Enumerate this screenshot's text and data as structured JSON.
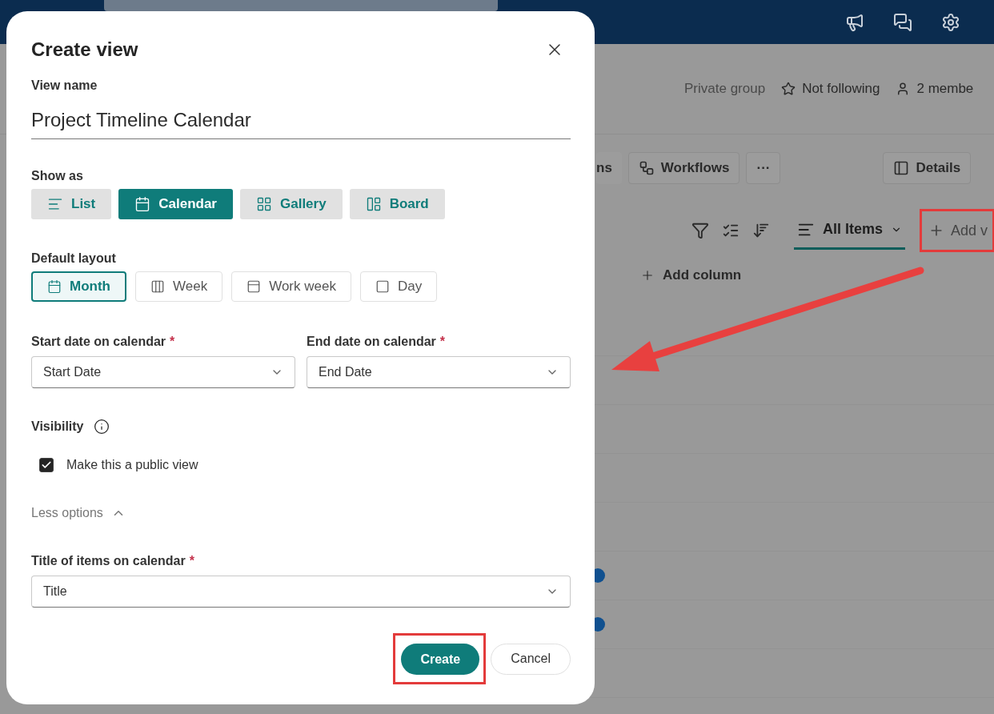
{
  "page": {
    "header": {
      "privacy": "Private group",
      "follow": "Not following",
      "members": "2 membe"
    },
    "toolbar": {
      "cut_label": "ns",
      "workflows": "Workflows",
      "more": "···",
      "details": "Details"
    },
    "views": {
      "current": {
        "label": "All Items",
        "selected": true
      },
      "add": "Add v"
    },
    "add_column": "Add column",
    "rows": [
      {
        "indicator": false
      },
      {
        "indicator": false
      },
      {
        "indicator": false
      },
      {
        "indicator": false
      },
      {
        "indicator": false
      },
      {
        "indicator": true
      },
      {
        "indicator": true
      },
      {
        "indicator": false
      }
    ]
  },
  "dialog": {
    "title": "Create view",
    "view_name": {
      "label": "View name",
      "value": "Project Timeline Calendar"
    },
    "show_as": {
      "label": "Show as",
      "options": [
        {
          "label": "List",
          "selected": false
        },
        {
          "label": "Calendar",
          "selected": true
        },
        {
          "label": "Gallery",
          "selected": false
        },
        {
          "label": "Board",
          "selected": false
        }
      ]
    },
    "default_layout": {
      "label": "Default layout",
      "options": [
        {
          "label": "Month",
          "selected": true
        },
        {
          "label": "Week",
          "selected": false
        },
        {
          "label": "Work week",
          "selected": false
        },
        {
          "label": "Day",
          "selected": false
        }
      ]
    },
    "date_fields": [
      {
        "label": "Start date on calendar",
        "required_mark": "*",
        "value": "Start Date"
      },
      {
        "label": "End date on calendar",
        "required_mark": "*",
        "value": "End Date"
      }
    ],
    "visibility": {
      "label": "Visibility",
      "checkbox": {
        "label": "Make this a public view",
        "checked": true
      }
    },
    "options_toggle": {
      "label": "Less options",
      "expanded": true
    },
    "title_field": {
      "label": "Title of items on calendar",
      "required_mark": "*",
      "value": "Title"
    },
    "buttons": [
      {
        "label": "Create",
        "kind": "primary"
      },
      {
        "label": "Cancel",
        "kind": "secondary"
      }
    ]
  }
}
